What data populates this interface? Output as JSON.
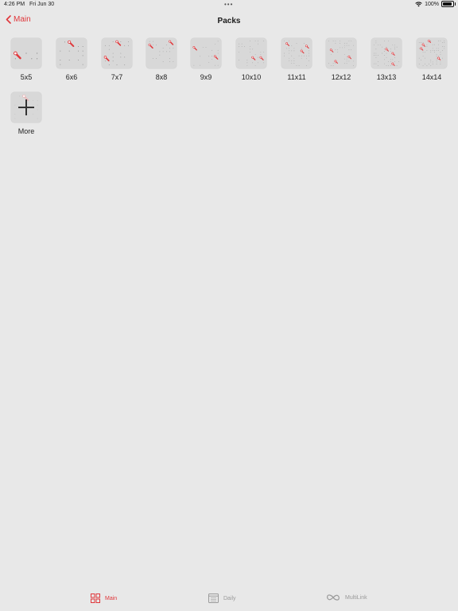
{
  "status": {
    "time": "4:26 PM",
    "date": "Fri Jun 30",
    "battery": "100%",
    "battery_level": 1.0,
    "dots_icon": "more-dots-icon",
    "wifi_icon": "wifi-icon",
    "battery_icon": "battery-icon"
  },
  "nav": {
    "back_label": "Main",
    "back_icon": "chevron-left-icon",
    "title": "Packs"
  },
  "packs": [
    {
      "label": "5x5"
    },
    {
      "label": "6x6"
    },
    {
      "label": "7x7"
    },
    {
      "label": "8x8"
    },
    {
      "label": "9x9"
    },
    {
      "label": "10x10"
    },
    {
      "label": "11x11"
    },
    {
      "label": "12x12"
    },
    {
      "label": "13x13"
    },
    {
      "label": "14x14"
    }
  ],
  "more": {
    "label": "More",
    "icon": "plus-icon"
  },
  "tabs": [
    {
      "label": "Main",
      "icon": "grid-icon",
      "active": true
    },
    {
      "label": "Daily",
      "icon": "calendar-icon",
      "active": false
    },
    {
      "label": "MultiLink",
      "icon": "infinity-icon",
      "active": false
    }
  ],
  "colors": {
    "accent": "#e0373b",
    "background": "#e8e8e8",
    "thumb_background": "#d8d8d8",
    "inactive_tab": "#9a9a9a"
  }
}
